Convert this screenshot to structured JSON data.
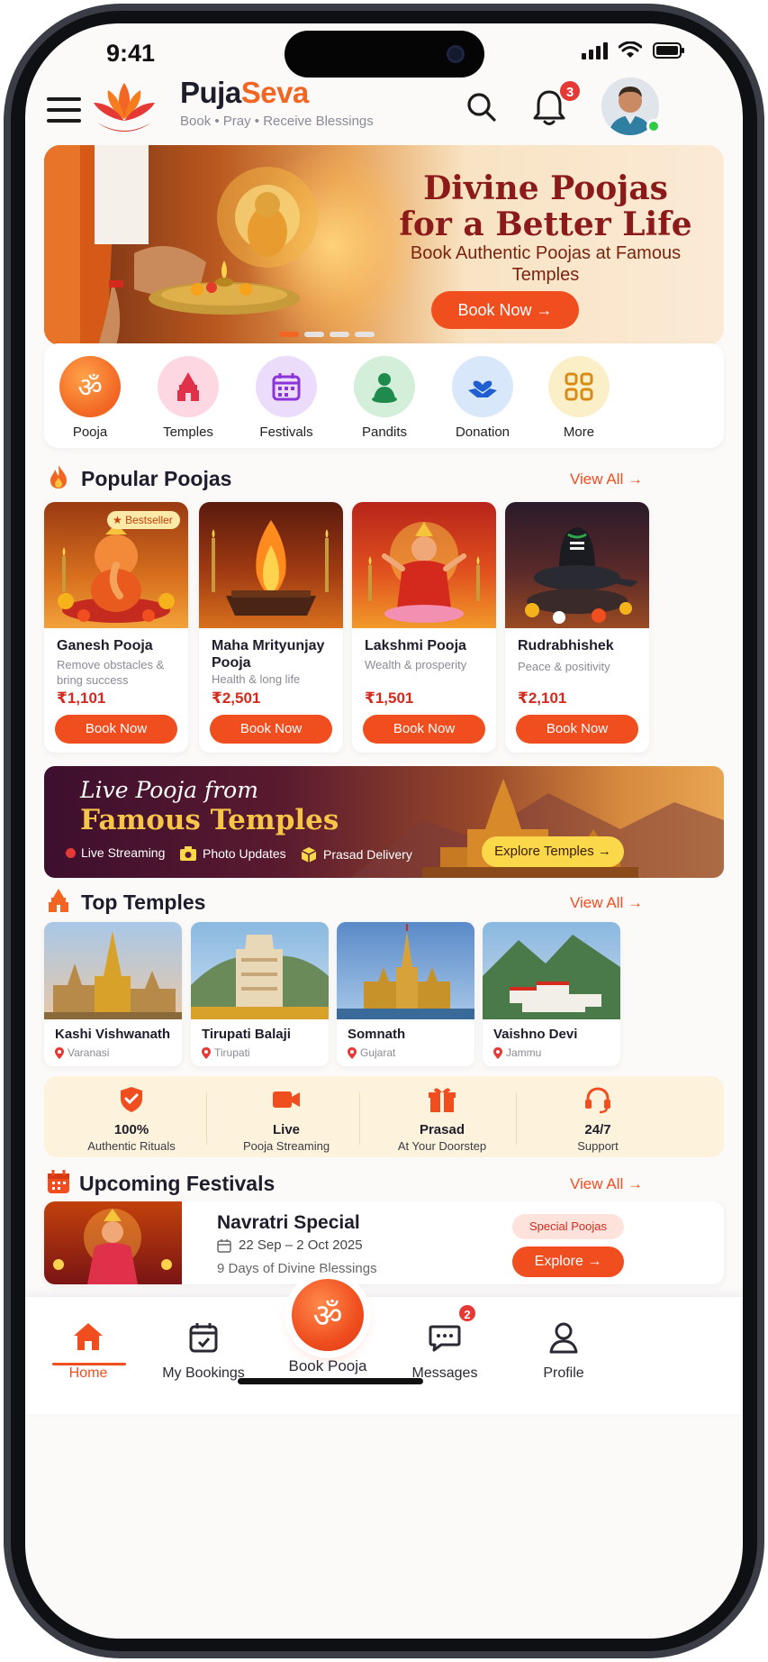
{
  "status": {
    "time": "9:41"
  },
  "header": {
    "brand_a": "Puja",
    "brand_b": "Seva",
    "tagline": "Book • Pray • Receive Blessings",
    "notification_count": "3"
  },
  "hero": {
    "title": "Divine Poojas for a Better Life",
    "subtitle": "Book Authentic Poojas at Famous Temples",
    "button": "Book Now →",
    "active_slide": 1,
    "slides": 4
  },
  "categories": [
    {
      "label": "Pooja",
      "icon": "om-icon"
    },
    {
      "label": "Temples",
      "icon": "temple-icon"
    },
    {
      "label": "Festivals",
      "icon": "calendar-icon"
    },
    {
      "label": "Pandits",
      "icon": "pandit-icon"
    },
    {
      "label": "Donation",
      "icon": "heart-hands-icon"
    },
    {
      "label": "More",
      "icon": "grid-icon"
    }
  ],
  "popular": {
    "title": "Popular Poojas",
    "view_all": "View All →",
    "badge": "Bestseller",
    "items": [
      {
        "name": "Ganesh Pooja",
        "desc": "Remove obstacles & bring success",
        "price": "₹1,101",
        "button": "Book Now"
      },
      {
        "name": "Maha Mrityunjay Pooja",
        "desc": "Health & long life",
        "price": "₹2,501",
        "button": "Book Now"
      },
      {
        "name": "Lakshmi Pooja",
        "desc": "Wealth & prosperity",
        "price": "₹1,501",
        "button": "Book Now"
      },
      {
        "name": "Rudrabhishek",
        "desc": "Peace & positivity",
        "price": "₹2,101",
        "button": "Book Now"
      }
    ]
  },
  "live": {
    "line1": "Live Pooja from",
    "line2": "Famous Temples",
    "features": [
      "Live Streaming",
      "Photo Updates",
      "Prasad Delivery"
    ],
    "button": "Explore Temples →"
  },
  "temples": {
    "title": "Top Temples",
    "view_all": "View All →",
    "items": [
      {
        "name": "Kashi Vishwanath",
        "location": "Varanasi"
      },
      {
        "name": "Tirupati Balaji",
        "location": "Tirupati"
      },
      {
        "name": "Somnath",
        "location": "Gujarat"
      },
      {
        "name": "Vaishno Devi",
        "location": "Jammu"
      }
    ]
  },
  "trust": [
    {
      "a": "100%",
      "b": "Authentic Rituals",
      "icon": "shield-icon"
    },
    {
      "a": "Live",
      "b": "Pooja Streaming",
      "icon": "video-icon"
    },
    {
      "a": "Prasad",
      "b": "At Your Doorstep",
      "icon": "gift-icon"
    },
    {
      "a": "24/7",
      "b": "Support",
      "icon": "headset-icon"
    }
  ],
  "festivals": {
    "title": "Upcoming Festivals",
    "view_all": "View All →",
    "item": {
      "name": "Navratri Special",
      "dates": "22 Sep – 2 Oct 2025",
      "subtitle": "9 Days of Divine Blessings",
      "badge": "Special Poojas",
      "button": "Explore →"
    }
  },
  "bottom_nav": {
    "home": "Home",
    "bookings": "My Bookings",
    "book_pooja": "Book Pooja",
    "messages": "Messages",
    "messages_count": "2",
    "profile": "Profile"
  },
  "colors": {
    "accent": "#f04e1f",
    "brand_orange": "#f26522",
    "price_red": "#d42a1e",
    "gold": "#f7c548"
  }
}
